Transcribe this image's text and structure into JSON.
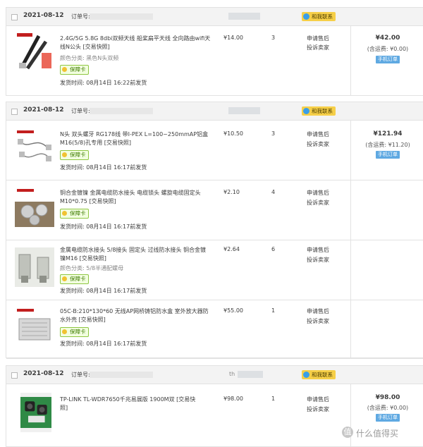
{
  "orders": [
    {
      "date": "2021-08-12",
      "order_no_label": "订单号: 2",
      "seller": "",
      "contact": "和我联系",
      "total": "¥42.00",
      "freight": "(含运费: ¥0.00)",
      "mobile": "手机订单",
      "items": [
        {
          "title": "2.4G/5G 5.8G 8dbi双频天线 船桨扁平天线 全向路由wifi天线N公头 [交易快照]",
          "spec_label": "颜色分类:",
          "spec_value": "黑色N头双频",
          "guarantee": "保障卡",
          "ship": "发货时间: 08月14日 16:22前发货",
          "price": "¥14.00",
          "qty": "3",
          "act1": "申请售后",
          "act2": "投诉卖家"
        }
      ]
    },
    {
      "date": "2021-08-12",
      "order_no_label": "订单号: 20",
      "seller": "",
      "contact": "和我联系",
      "total": "¥121.94",
      "freight": "(含运费: ¥11.20)",
      "mobile": "手机订单",
      "items": [
        {
          "title": "N头 双头螺牙 RG178线 带I-PEX L=100~250mmAP铝盒M16(5/8)孔专用 [交易快照]",
          "spec_label": "",
          "spec_value": "",
          "guarantee": "保障卡",
          "ship": "发货时间: 08月14日 16:17前发货",
          "price": "¥10.50",
          "qty": "3",
          "act1": "申请售后",
          "act2": "投诉卖家"
        },
        {
          "title": "铜合金镀镍 金属电缆防水接头 电缆锁头 螺旋电缆固定头 M10*0.75 [交易快照]",
          "spec_label": "",
          "spec_value": "",
          "guarantee": "保障卡",
          "ship": "发货时间: 08月14日 16:17前发货",
          "price": "¥2.10",
          "qty": "4",
          "act1": "申请售后",
          "act2": "投诉卖家"
        },
        {
          "title": "金属电缆防水接头 5/8接头 固定头 过线防水接头 铜合金镀镍M16 [交易快照]",
          "spec_label": "颜色分类:",
          "spec_value": "5/8半通配螺母",
          "guarantee": "保障卡",
          "ship": "发货时间: 08月14日 16:17前发货",
          "price": "¥2.64",
          "qty": "6",
          "act1": "申请售后",
          "act2": "投诉卖家"
        },
        {
          "title": "05C-B:210*130*60 无线AP网桥铸铝防水盒 室外放大器防水外壳 [交易快照]",
          "spec_label": "",
          "spec_value": "",
          "guarantee": "保障卡",
          "ship": "发货时间: 08月14日 16:17前发货",
          "price": "¥55.00",
          "qty": "1",
          "act1": "申请售后",
          "act2": "投诉卖家"
        }
      ]
    },
    {
      "date": "2021-08-12",
      "order_no_label": "订单号: 202",
      "seller": "th",
      "contact": "和我联系",
      "total": "¥98.00",
      "freight": "(含运费: ¥0.00)",
      "mobile": "手机订单",
      "items": [
        {
          "title": "TP-LINK TL-WDR7650千兆易展版 1900M双 [交易快照]",
          "spec_label": "",
          "spec_value": "",
          "guarantee": "",
          "ship": "",
          "price": "¥98.00",
          "qty": "1",
          "act1": "申请售后",
          "act2": "投诉卖家"
        }
      ]
    }
  ],
  "watermark": "什么值得买",
  "colors": {
    "header_bg": "#f3f3f3",
    "border": "#e2e2e2",
    "contact": "#f6cf48",
    "mobile": "#5fa9e2",
    "guarantee": "#8fc642"
  }
}
